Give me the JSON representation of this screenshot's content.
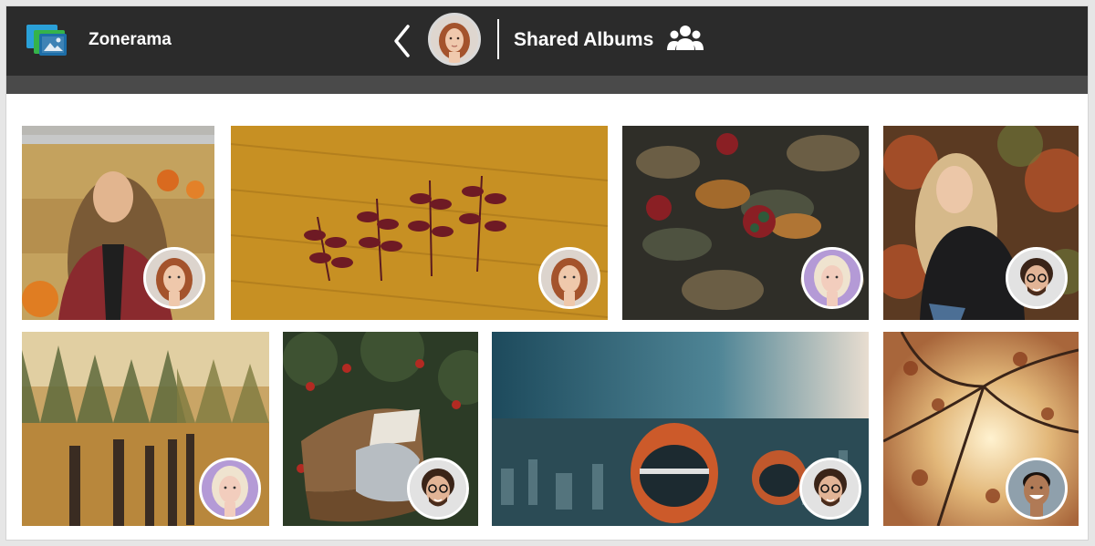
{
  "app": {
    "name": "Zonerama",
    "logo_icon": "zonerama-logo-icon"
  },
  "header": {
    "back_icon": "chevron-left-icon",
    "title": "Shared Albums",
    "people_icon": "people-group-icon",
    "owner_avatar": "owner-avatar-red-hair-woman"
  },
  "colors": {
    "topbar": "#2b2b2b",
    "subbar": "#4a4a4a",
    "background": "#ffffff"
  },
  "photos": [
    {
      "subject": "Smiling woman with curly hair by hay bales and pumpkins",
      "sharer": "red-hair-woman"
    },
    {
      "subject": "Dark red leaves on mustard knit sweater",
      "sharer": "red-hair-woman"
    },
    {
      "subject": "Autumn leaves with dark berries",
      "sharer": "blonde-woman-purple-light"
    },
    {
      "subject": "Blonde woman sitting in autumn forest",
      "sharer": "man-with-glasses"
    },
    {
      "subject": "Foggy autumn field with wooden fence",
      "sharer": "blonde-woman-purple-light"
    },
    {
      "subject": "Wicker picnic basket with book under apple tree",
      "sharer": "man-with-glasses"
    },
    {
      "subject": "Ferris wheel cabins over foggy city",
      "sharer": "man-with-glasses"
    },
    {
      "subject": "Autumn tree branches with golden sunlight",
      "sharer": "smiling-man"
    }
  ]
}
